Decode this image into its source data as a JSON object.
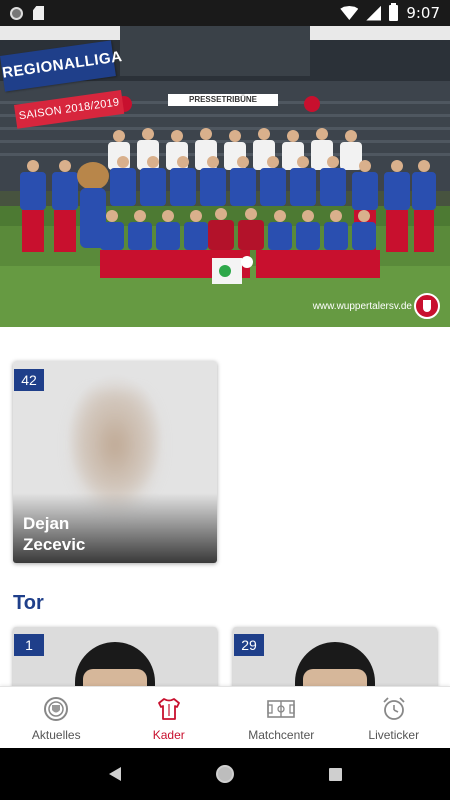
{
  "status_bar": {
    "time": "9:07"
  },
  "banner": {
    "league_badge": "REGIONALLIGA",
    "season_badge": "SAISON 2018/2019",
    "stand_sign": "PRESSETRIBÜNE",
    "website": "www.wuppertalersv.de"
  },
  "featured_player": {
    "number": "42",
    "first_name": "Dejan",
    "last_name": "Zecevic"
  },
  "sections": [
    {
      "title": "Tor",
      "players": [
        {
          "number": "1"
        },
        {
          "number": "29"
        }
      ]
    }
  ],
  "bottom_nav": {
    "items": [
      {
        "label": "Aktuelles",
        "icon": "club-crest-icon",
        "active": false
      },
      {
        "label": "Kader",
        "icon": "jersey-icon",
        "active": true
      },
      {
        "label": "Matchcenter",
        "icon": "pitch-icon",
        "active": false
      },
      {
        "label": "Liveticker",
        "icon": "alarm-clock-icon",
        "active": false
      }
    ]
  },
  "colors": {
    "primary_blue": "#1f3f8a",
    "accent_red": "#c8102e"
  }
}
